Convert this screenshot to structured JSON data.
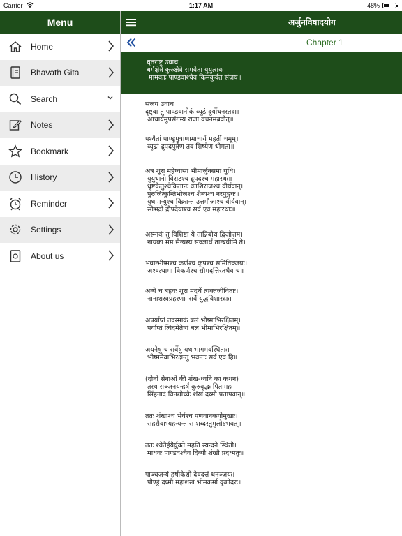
{
  "status": {
    "carrier": "Carrier",
    "time": "1:17 AM",
    "battery": "48%",
    "battery_level": 0.48
  },
  "sidebar": {
    "title": "Menu",
    "items": [
      {
        "label": "Home",
        "icon": "home-icon"
      },
      {
        "label": "Bhavath Gita",
        "icon": "book-icon"
      },
      {
        "label": "Search",
        "icon": "search-icon"
      },
      {
        "label": "Notes",
        "icon": "notes-icon"
      },
      {
        "label": "Bookmark",
        "icon": "star-icon"
      },
      {
        "label": "History",
        "icon": "clock-icon"
      },
      {
        "label": "Reminder",
        "icon": "alarm-icon"
      },
      {
        "label": "Settings",
        "icon": "gear-icon"
      },
      {
        "label": "About us",
        "icon": "about-icon"
      }
    ]
  },
  "header": {
    "title": "अर्जुनविषादयोग"
  },
  "chapter": {
    "label": "Chapter 1"
  },
  "verses": [
    {
      "lines": [
        "धृतराष्ट्र उवाच",
        "धर्मक्षेत्रे कुरुक्षेत्रे समवेता युयुत्सवः।",
        " मामकाः पाण्डवाश्चैव किमकुर्वत संजय॥"
      ]
    },
    {
      "lines": [
        "संजय उवाच",
        "दृष्ट्वा तु पाण्डवानीकं व्यूढं दुर्योधनस्तदा।",
        " आचार्यमुपसंगम्य राजा वचनमब्रवीत्॥"
      ]
    },
    {
      "lines": [
        "पश्यैतां पाण्डुपुत्राणामाचार्य महतीं चमूम्।",
        " व्यूढां द्रुपदपुत्रेण तव शिष्येण धीमता॥"
      ]
    },
    {
      "lines": [
        "अत्र शूरा महेष्वासा भीमार्जुनसमा युधि।",
        " युयुधानो विराटश्च द्रुपदश्च महारथः॥",
        " धृष्टकेतुश्चेकितानः काशिराजश्च वीर्यवान्।",
        " पुरुजित्कुन्तिभोजश्च शैब्यश्च नरपुङ्गवः॥",
        " युधामन्युश्च विक्रान्त उत्तमौजाश्च वीर्यवान्।",
        " सौभद्रो द्रौपदेयाश्च सर्व एव महारथाः॥"
      ]
    },
    {
      "lines": [
        "अस्माकं तु विशिष्टा ये तान्निबोध द्विजोत्तम।",
        " नायका मम सैन्यस्य सञ्ज्ञार्थं तान्ब्रवीमि ते॥"
      ]
    },
    {
      "lines": [
        "भवान्भीष्मश्च कर्णश्च कृपश्च समितिञ्जयः।",
        " अश्वत्थामा विकर्णश्च सौमदत्तिस्तथैव च॥"
      ]
    },
    {
      "lines": [
        "अन्ये च बहवः शूरा मदर्थे त्यक्तजीविताः।",
        " नानाशस्त्रप्रहरणाः सर्वे युद्धविशारदाः॥"
      ]
    },
    {
      "lines": [
        "अपर्याप्तं तदस्माकं बलं भीष्माभिरक्षितम्।",
        " पर्याप्तं त्विदमेतेषां बलं भीमाभिरक्षितम्॥"
      ]
    },
    {
      "lines": [
        "अयनेषु च सर्वेषु यथाभागमवस्थिताः।",
        " भीष्ममेवाभिरक्षन्तु भवन्तः सर्व एव हि॥"
      ]
    },
    {
      "lines": [
        "(दोनों सेनाओं की शंख-ध्वनि का कथन)",
        " तस्य सञ्जनयन्हर्षं कुरुवृद्धः पितामहः।",
        " सिंहनादं विनद्योच्चैः शंखं दध्मो प्रतापवान्॥"
      ]
    },
    {
      "lines": [
        "ततः शंखाश्च भेर्यश्च पणवानकगोमुखाः।",
        " सहसैवाभ्यहन्यन्त स शब्दस्तुमुलोऽभवत्॥"
      ]
    },
    {
      "lines": [
        "ततः श्वेतैर्हयैर्युक्ते महति स्यन्दने स्थितौ।",
        " माधवः पाण्डवश्चैव दिव्यौ शंखौ प्रदध्मतुः॥"
      ]
    },
    {
      "lines": [
        "पाञ्चजन्यं हृषीकेशो देवदत्तं धनञ्जयः।",
        " पौण्ड्रं दध्मौ महाशंखं भीमकर्मा वृकोदरः॥"
      ]
    }
  ]
}
